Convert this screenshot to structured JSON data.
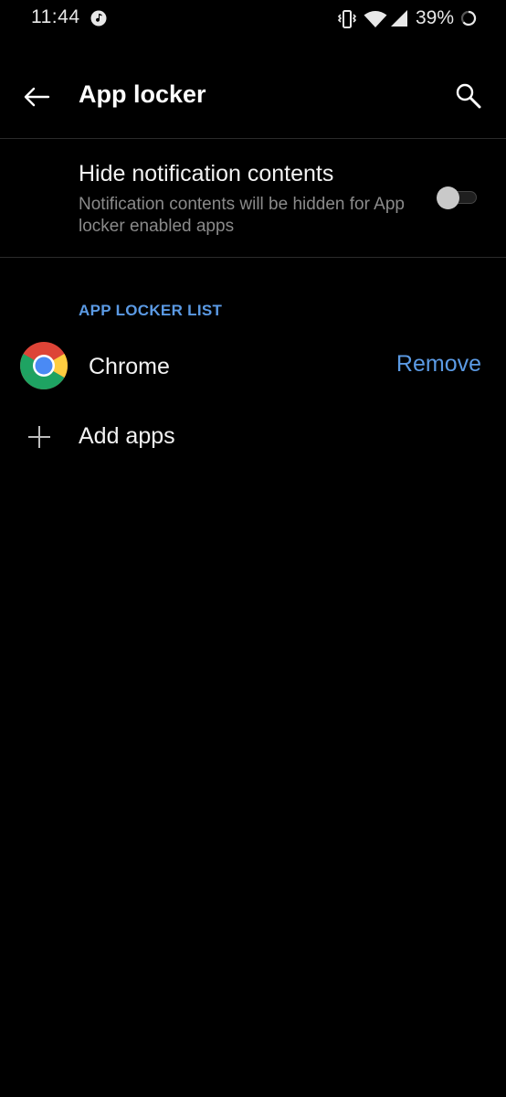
{
  "status_bar": {
    "time": "11:44",
    "battery": "39%",
    "icons": [
      "music-note-icon",
      "vibrate-icon",
      "wifi-icon",
      "cell-signal-icon",
      "battery-saver-icon"
    ]
  },
  "app_bar": {
    "title": "App locker",
    "back_icon": "arrow-back-icon",
    "search_icon": "search-icon"
  },
  "setting": {
    "title": "Hide notification contents",
    "description": "Notification contents will be hidden for App locker enabled apps",
    "enabled": false
  },
  "section": {
    "header": "APP LOCKER LIST"
  },
  "apps": [
    {
      "name": "Chrome",
      "icon": "chrome-icon",
      "action": "Remove"
    }
  ],
  "add": {
    "label": "Add apps",
    "icon": "plus-icon"
  },
  "colors": {
    "background": "#000000",
    "accent": "#5b9ae4",
    "secondary_text": "#8a8a8a"
  }
}
